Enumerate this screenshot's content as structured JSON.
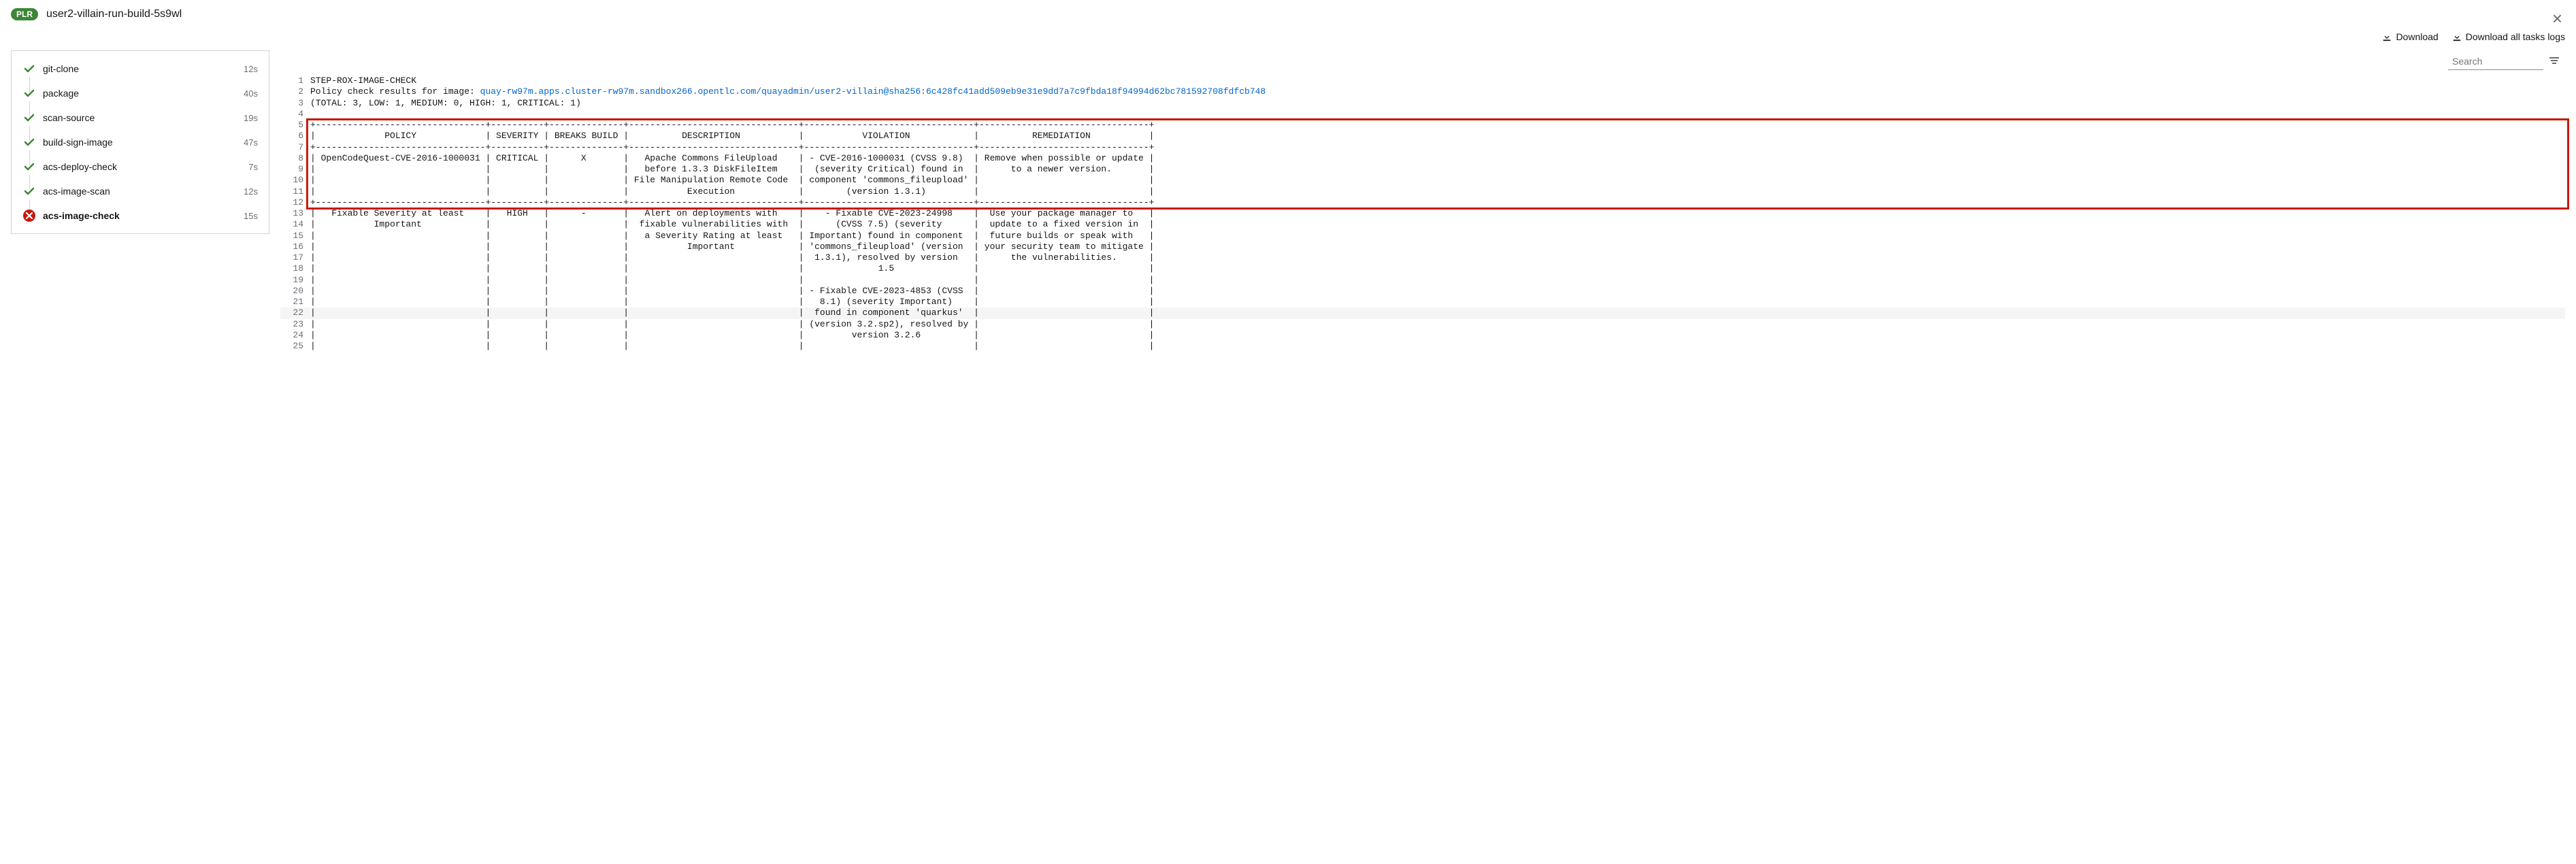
{
  "header": {
    "badge": "PLR",
    "title": "user2-villain-run-build-5s9wl"
  },
  "actions": {
    "download": "Download",
    "downloadAll": "Download all tasks logs"
  },
  "search": {
    "placeholder": "Search"
  },
  "tasks": [
    {
      "name": "git-clone",
      "time": "12s",
      "status": "ok"
    },
    {
      "name": "package",
      "time": "40s",
      "status": "ok"
    },
    {
      "name": "scan-source",
      "time": "19s",
      "status": "ok"
    },
    {
      "name": "build-sign-image",
      "time": "47s",
      "status": "ok"
    },
    {
      "name": "acs-deploy-check",
      "time": "7s",
      "status": "ok"
    },
    {
      "name": "acs-image-scan",
      "time": "12s",
      "status": "ok"
    },
    {
      "name": "acs-image-check",
      "time": "15s",
      "status": "fail",
      "selected": true
    }
  ],
  "log": {
    "link_prefix": "Policy check results for image: ",
    "link": "quay-rw97m.apps.cluster-rw97m.sandbox266.opentlc.com/quayadmin/user2-villain@sha256:6c428fc41add509eb9e31e9dd7a7c9fbda18f94994d62bc781592708fdfcb748",
    "lines": [
      "STEP-ROX-IMAGE-CHECK",
      "",
      "(TOTAL: 3, LOW: 1, MEDIUM: 0, HIGH: 1, CRITICAL: 1)",
      "",
      "+--------------------------------+----------+--------------+--------------------------------+--------------------------------+--------------------------------+",
      "|             POLICY             | SEVERITY | BREAKS BUILD |          DESCRIPTION           |           VIOLATION            |          REMEDIATION           |",
      "+--------------------------------+----------+--------------+--------------------------------+--------------------------------+--------------------------------+",
      "| OpenCodeQuest-CVE-2016-1000031 | CRITICAL |      X       |   Apache Commons FileUpload    | - CVE-2016-1000031 (CVSS 9.8)  | Remove when possible or update |",
      "|                                |          |              |   before 1.3.3 DiskFileItem    |  (severity Critical) found in  |      to a newer version.       |",
      "|                                |          |              | File Manipulation Remote Code  | component 'commons_fileupload' |                                |",
      "|                                |          |              |           Execution            |        (version 1.3.1)         |                                |",
      "+--------------------------------+----------+--------------+--------------------------------+--------------------------------+--------------------------------+",
      "|   Fixable Severity at least    |   HIGH   |      -       |   Alert on deployments with    |    - Fixable CVE-2023-24998    |  Use your package manager to   |",
      "|           Important            |          |              |  fixable vulnerabilities with  |      (CVSS 7.5) (severity      |  update to a fixed version in  |",
      "|                                |          |              |   a Severity Rating at least   | Important) found in component  |  future builds or speak with   |",
      "|                                |          |              |           Important            | 'commons_fileupload' (version  | your security team to mitigate |",
      "|                                |          |              |                                |  1.3.1), resolved by version   |      the vulnerabilities.      |",
      "|                                |          |              |                                |              1.5               |                                |",
      "|                                |          |              |                                |                                |                                |",
      "|                                |          |              |                                | - Fixable CVE-2023-4853 (CVSS  |                                |",
      "|                                |          |              |                                |   8.1) (severity Important)    |                                |",
      "|                                |          |              |                                |  found in component 'quarkus'  |                                |",
      "|                                |          |              |                                | (version 3.2.sp2), resolved by |                                |",
      "|                                |          |              |                                |         version 3.2.6          |                                |",
      "|                                |          |              |                                |                                |                                |"
    ]
  }
}
